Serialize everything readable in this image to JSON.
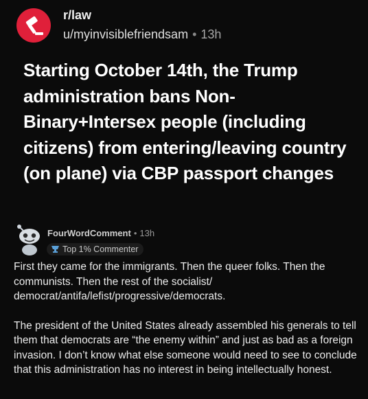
{
  "post": {
    "subreddit": "r/law",
    "author": "u/myinvisiblefriendsam",
    "separator": "•",
    "age": "13h",
    "title": "Starting October 14th, the Trump administration bans Non-Binary+Intersex people (including citizens) from entering/leaving country (on plane) via CBP passport changes"
  },
  "comment": {
    "author": "FourWordComment",
    "separator": "•",
    "age": "13h",
    "badge": "Top 1% Commenter",
    "paragraphs": [
      "First they came for the immigrants. Then the queer folks. Then the communists. Then the rest of the socialist/ democrat/antifa/lefist/progressive/democrats.",
      "The president of the United States already assembled his generals to tell them that democrats are “the enemy within” and just as bad as a foreign invasion. I don’t know what else someone would need to see to conclude that this administration has no interest in being intellectually honest."
    ]
  },
  "icons": {
    "subreddit": "gavel-icon",
    "avatar": "snoo-avatar-icon",
    "badge": "trophy-icon"
  },
  "colors": {
    "background": "#0b0b0b",
    "subreddit_icon": "#e0203a"
  }
}
